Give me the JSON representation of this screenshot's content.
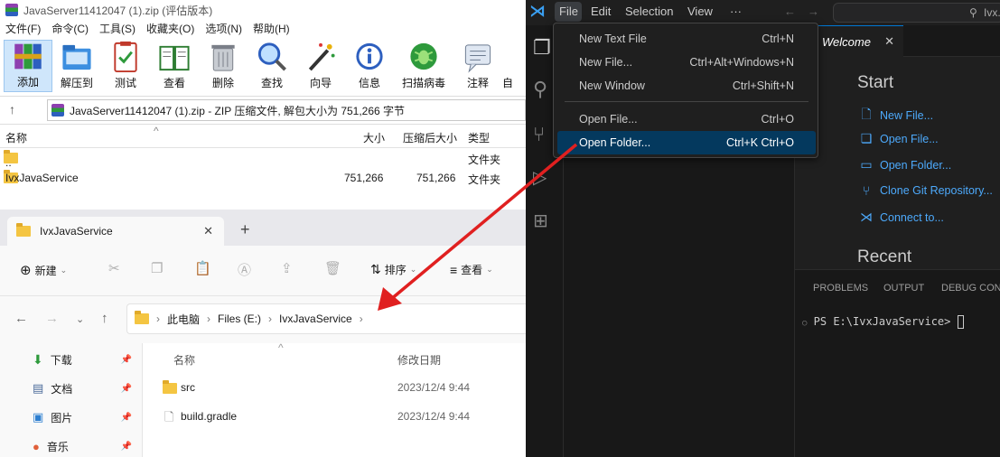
{
  "winrar": {
    "title": "JavaServer11412047 (1).zip (评估版本)",
    "menu": [
      "文件(F)",
      "命令(C)",
      "工具(S)",
      "收藏夹(O)",
      "选项(N)",
      "帮助(H)"
    ],
    "toolbar": [
      "添加",
      "解压到",
      "测试",
      "查看",
      "删除",
      "查找",
      "向导",
      "信息",
      "扫描病毒",
      "注释",
      "自"
    ],
    "path": "JavaServer11412047 (1).zip - ZIP 压缩文件, 解包大小为 751,266 字节",
    "columns": {
      "name": "名称",
      "size": "大小",
      "packed": "压缩后大小",
      "type": "类型"
    },
    "rows": [
      {
        "name": "..",
        "size": "",
        "packed": "",
        "type": "文件夹"
      },
      {
        "name": "IvxJavaService",
        "size": "751,266",
        "packed": "751,266",
        "type": "文件夹"
      }
    ]
  },
  "explorer": {
    "tab_title": "IvxJavaService",
    "new_label": "新建",
    "sort_label": "排序",
    "view_label": "查看",
    "breadcrumb": [
      "此电脑",
      "Files (E:)",
      "IvxJavaService"
    ],
    "sidebar": [
      {
        "label": "下载",
        "icon": "download-icon"
      },
      {
        "label": "文档",
        "icon": "document-icon"
      },
      {
        "label": "图片",
        "icon": "picture-icon"
      },
      {
        "label": "音乐",
        "icon": "music-icon"
      }
    ],
    "columns": {
      "name": "名称",
      "modified": "修改日期"
    },
    "files": [
      {
        "name": "src",
        "modified": "2023/12/4 9:44",
        "icon": "folder-icon"
      },
      {
        "name": "build.gradle",
        "modified": "2023/12/4 9:44",
        "icon": "file-icon"
      }
    ]
  },
  "vscode": {
    "menu": [
      "File",
      "Edit",
      "Selection",
      "View",
      "···"
    ],
    "search_placeholder": "Ivx...",
    "file_menu": [
      {
        "label": "New Text File",
        "shortcut": "Ctrl+N"
      },
      {
        "label": "New File...",
        "shortcut": "Ctrl+Alt+Windows+N"
      },
      {
        "label": "New Window",
        "shortcut": "Ctrl+Shift+N"
      },
      {
        "label": "Open File...",
        "shortcut": "Ctrl+O"
      },
      {
        "label": "Open Folder...",
        "shortcut": "Ctrl+K Ctrl+O"
      }
    ],
    "tab_label": "Welcome",
    "start_heading": "Start",
    "start_links": [
      "New File...",
      "Open File...",
      "Open Folder...",
      "Clone Git Repository...",
      "Connect to..."
    ],
    "recent_heading": "Recent",
    "panel_tabs": [
      "PROBLEMS",
      "OUTPUT",
      "DEBUG CONS"
    ],
    "terminal_prompt": "PS E:\\IvxJavaService> ",
    "colors": {
      "accent": "#0078d4",
      "link": "#4daafc",
      "highlight": "#04395e",
      "arrow": "#e02020"
    }
  }
}
